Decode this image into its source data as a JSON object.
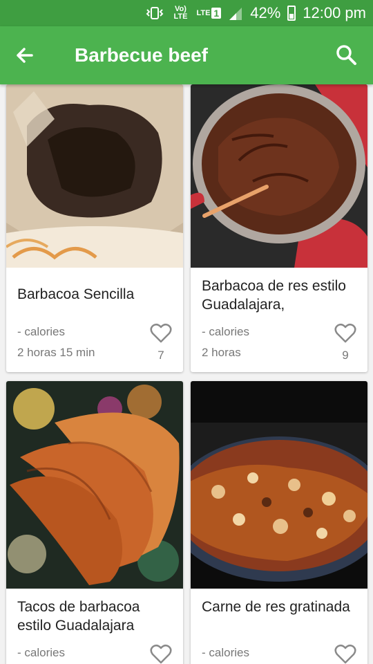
{
  "status_bar": {
    "volte": "Vo) LTE",
    "lte": "LTE",
    "sim": "1",
    "battery": "42%",
    "time": "12:00 pm"
  },
  "app_bar": {
    "title": "Barbecue beef"
  },
  "recipes": [
    {
      "name": "Barbacoa Sencilla",
      "calories": "- calories",
      "time": "2 horas 15 min",
      "likes": "7"
    },
    {
      "name": "Barbacoa de res estilo Guadalajara,",
      "calories": "- calories",
      "time": "2 horas",
      "likes": "9"
    },
    {
      "name": "Tacos de barbacoa estilo Guadalajara",
      "calories": "- calories",
      "time": "",
      "likes": ""
    },
    {
      "name": "Carne de res gratinada",
      "calories": "- calories",
      "time": "",
      "likes": ""
    }
  ],
  "colors": {
    "status_bar": "#3f9e41",
    "app_bar": "#4cb34f"
  }
}
